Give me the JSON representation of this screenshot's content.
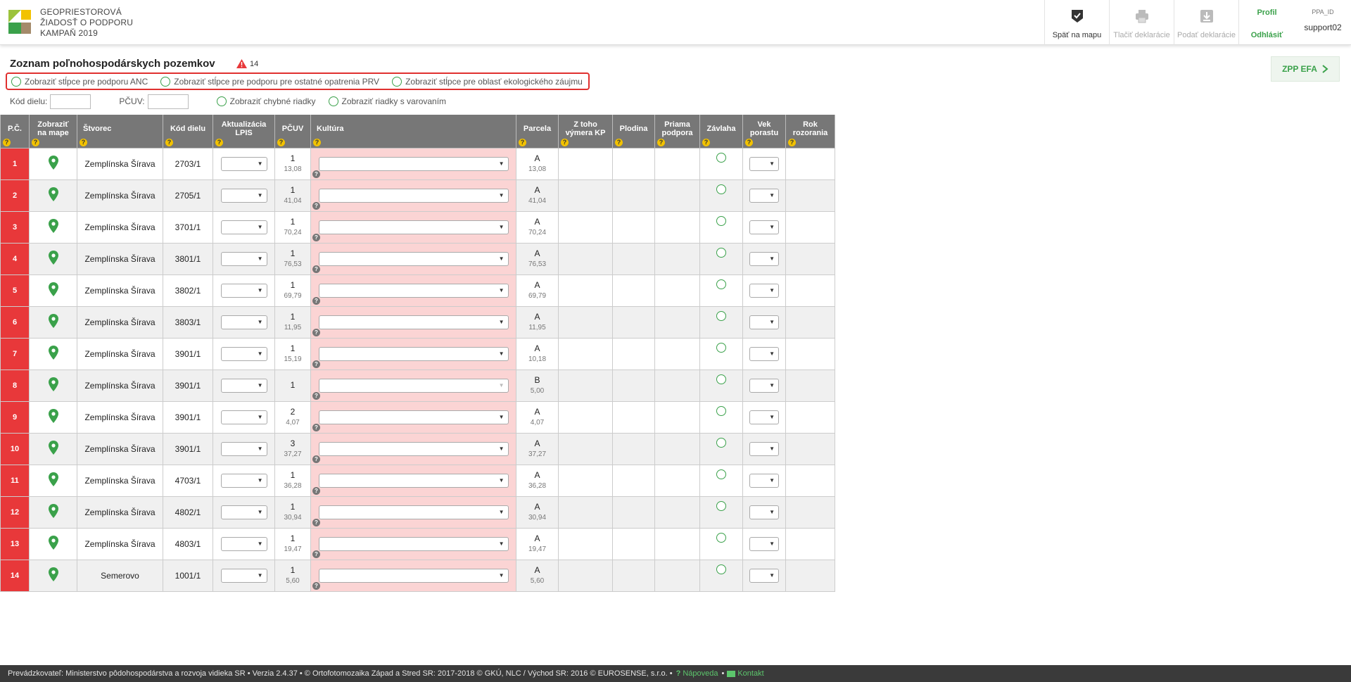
{
  "header": {
    "title_lines": [
      "GEOPRIESTOROVÁ",
      "ŽIADOSŤ O PODPORU",
      "KAMPAŇ 2019"
    ],
    "back_to_map": "Späť na mapu",
    "print_declaration": "Tlačiť deklarácie",
    "submit_declaration": "Podať deklarácie",
    "profile": "Profil",
    "logout": "Odhlásiť",
    "ppa_id_label": "PPA_ID",
    "user": "support02"
  },
  "page": {
    "title": "Zoznam poľnohospodárskych pozemkov",
    "warning_count": "14",
    "zpp_button": "ZPP EFA"
  },
  "toggles": [
    "Zobraziť stĺpce pre podporu ANC",
    "Zobraziť stĺpce pre podporu pre ostatné opatrenia PRV",
    "Zobraziť stĺpce pre oblasť ekologického záujmu"
  ],
  "filters": {
    "kod_dielu_label": "Kód dielu:",
    "pcuv_label": "PČUV:",
    "show_errors": "Zobraziť chybné riadky",
    "show_warnings": "Zobraziť riadky s varovaním"
  },
  "columns": {
    "pc": "P.Č.",
    "map": [
      "Zobraziť",
      "na mape"
    ],
    "stvorec": "Štvorec",
    "kod_dielu": "Kód dielu",
    "lpis": [
      "Aktualizácia",
      "LPIS"
    ],
    "pcuv": "PČUV",
    "kultura": "Kultúra",
    "parcela": "Parcela",
    "vymera": [
      "Z toho",
      "výmera KP"
    ],
    "plodina": "Plodina",
    "priama": [
      "Priama",
      "podpora"
    ],
    "zavlaha": "Závlaha",
    "vek": [
      "Vek",
      "porastu"
    ],
    "rok": [
      "Rok",
      "rozorania"
    ]
  },
  "rows": [
    {
      "n": "1",
      "stvorec": "Zemplínska Šírava",
      "kod": "2703/1",
      "pcuv": "1",
      "pcuv_area": "13,08",
      "parcela": "A",
      "parcela_area": "13,08"
    },
    {
      "n": "2",
      "stvorec": "Zemplínska Šírava",
      "kod": "2705/1",
      "pcuv": "1",
      "pcuv_area": "41,04",
      "parcela": "A",
      "parcela_area": "41,04"
    },
    {
      "n": "3",
      "stvorec": "Zemplínska Šírava",
      "kod": "3701/1",
      "pcuv": "1",
      "pcuv_area": "70,24",
      "parcela": "A",
      "parcela_area": "70,24"
    },
    {
      "n": "4",
      "stvorec": "Zemplínska Šírava",
      "kod": "3801/1",
      "pcuv": "1",
      "pcuv_area": "76,53",
      "parcela": "A",
      "parcela_area": "76,53"
    },
    {
      "n": "5",
      "stvorec": "Zemplínska Šírava",
      "kod": "3802/1",
      "pcuv": "1",
      "pcuv_area": "69,79",
      "parcela": "A",
      "parcela_area": "69,79"
    },
    {
      "n": "6",
      "stvorec": "Zemplínska Šírava",
      "kod": "3803/1",
      "pcuv": "1",
      "pcuv_area": "11,95",
      "parcela": "A",
      "parcela_area": "11,95"
    },
    {
      "n": "7",
      "stvorec": "Zemplínska Šírava",
      "kod": "3901/1",
      "pcuv": "1",
      "pcuv_area": "15,19",
      "parcela": "A",
      "parcela_area": "10,18"
    },
    {
      "n": "8",
      "stvorec": "Zemplínska Šírava",
      "kod": "3901/1",
      "pcuv": "1",
      "pcuv_area": "",
      "parcela": "B",
      "parcela_area": "5,00"
    },
    {
      "n": "9",
      "stvorec": "Zemplínska Šírava",
      "kod": "3901/1",
      "pcuv": "2",
      "pcuv_area": "4,07",
      "parcela": "A",
      "parcela_area": "4,07"
    },
    {
      "n": "10",
      "stvorec": "Zemplínska Šírava",
      "kod": "3901/1",
      "pcuv": "3",
      "pcuv_area": "37,27",
      "parcela": "A",
      "parcela_area": "37,27"
    },
    {
      "n": "11",
      "stvorec": "Zemplínska Šírava",
      "kod": "4703/1",
      "pcuv": "1",
      "pcuv_area": "36,28",
      "parcela": "A",
      "parcela_area": "36,28"
    },
    {
      "n": "12",
      "stvorec": "Zemplínska Šírava",
      "kod": "4802/1",
      "pcuv": "1",
      "pcuv_area": "30,94",
      "parcela": "A",
      "parcela_area": "30,94"
    },
    {
      "n": "13",
      "stvorec": "Zemplínska Šírava",
      "kod": "4803/1",
      "pcuv": "1",
      "pcuv_area": "19,47",
      "parcela": "A",
      "parcela_area": "19,47"
    },
    {
      "n": "14",
      "stvorec": "Semerovo",
      "kod": "1001/1",
      "pcuv": "1",
      "pcuv_area": "5,60",
      "parcela": "A",
      "parcela_area": "5,60"
    }
  ],
  "footer": {
    "text": "Prevádzkovateľ: Ministerstvo pôdohospodárstva a rozvoja vidieka SR • Verzia 2.4.37 • © Ortofotomozaika Západ a Stred SR: 2017-2018 © GKÚ, NLC / Východ SR: 2016 © EUROSENSE, s.r.o. •",
    "help": "Nápoveda",
    "sep": "•",
    "contact": "Kontakt"
  },
  "colors": {
    "accent_green": "#3aa14a",
    "error_red": "#e8383a",
    "header_gray": "#777777",
    "kultura_pink": "#fbd4d4"
  },
  "icons": {
    "back_to_map": "shield-check-icon",
    "print": "printer-icon",
    "submit": "download-icon",
    "map_pin": "map-pin-icon",
    "warning": "warning-triangle-icon",
    "help_badge": "question-icon"
  }
}
